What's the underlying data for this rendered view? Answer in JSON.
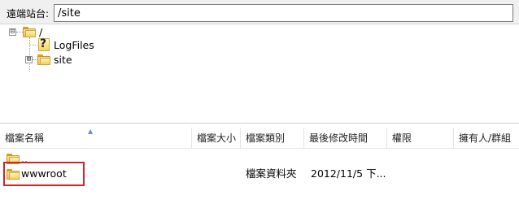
{
  "path_bar": {
    "label": "遠端站台:",
    "value": "/site"
  },
  "tree": {
    "root": {
      "label": "/",
      "expander": "⊟"
    },
    "children": [
      {
        "label": "LogFiles",
        "icon": "unknown-folder-icon"
      },
      {
        "label": "site",
        "icon": "folder-icon",
        "expander": "⊞"
      }
    ]
  },
  "list": {
    "columns": [
      "檔案名稱",
      "檔案大小",
      "檔案類別",
      "最後修改時間",
      "權限",
      "擁有人/群組"
    ],
    "rows": [
      {
        "name": "..",
        "size": "",
        "type": "",
        "modified": "",
        "perms": "",
        "owner": ""
      },
      {
        "name": "wwwroot",
        "size": "",
        "type": "檔案資料夾",
        "modified": "2012/11/5 下...",
        "perms": "",
        "owner": ""
      }
    ]
  },
  "colors": {
    "highlight": "#d0232a",
    "folder": "#f1c24b"
  }
}
